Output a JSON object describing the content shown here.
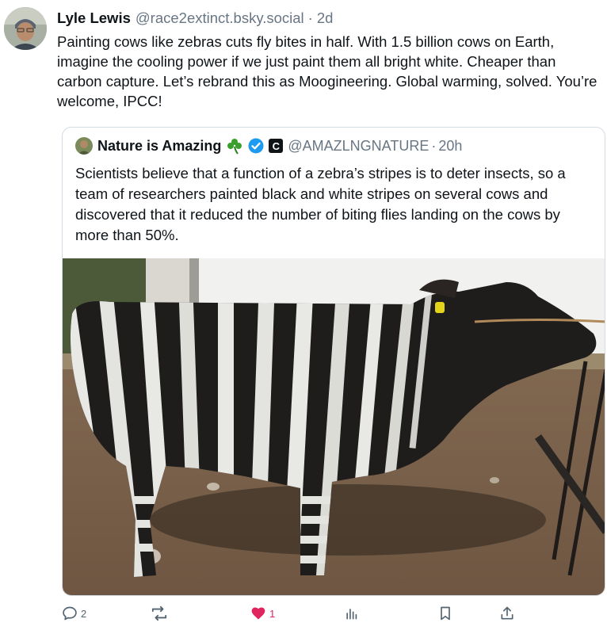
{
  "post": {
    "author_name": "Lyle Lewis",
    "author_handle": "@race2extinct.bsky.social",
    "separator": "·",
    "time": "2d",
    "text": "Painting cows like zebras cuts fly bites in half. With 1.5 billion cows on Earth, imagine the cooling power if we just paint them all bright white. Cheaper than carbon capture. Let’s rebrand this as Moogineering. Global warming, solved. You’re welcome, IPCC!"
  },
  "quote": {
    "author_name": "Nature is Amazing",
    "badge_letter": "C",
    "author_handle": "@AMAZLNGNATURE",
    "separator": "·",
    "time": "20h",
    "text": "Scientists believe that a function of a zebra’s stripes is to deter insects, so a team of researchers painted black and white stripes on several cows and discovered that it reduced the number of biting flies landing on the cows by more than 50%."
  },
  "actions": {
    "reply_count": "2",
    "repost_count": "",
    "like_count": "1",
    "like_color": "#e0245e",
    "icons": [
      "reply-icon",
      "repost-icon",
      "like-icon",
      "analytics-icon",
      "bookmark-icon",
      "share-icon"
    ]
  }
}
